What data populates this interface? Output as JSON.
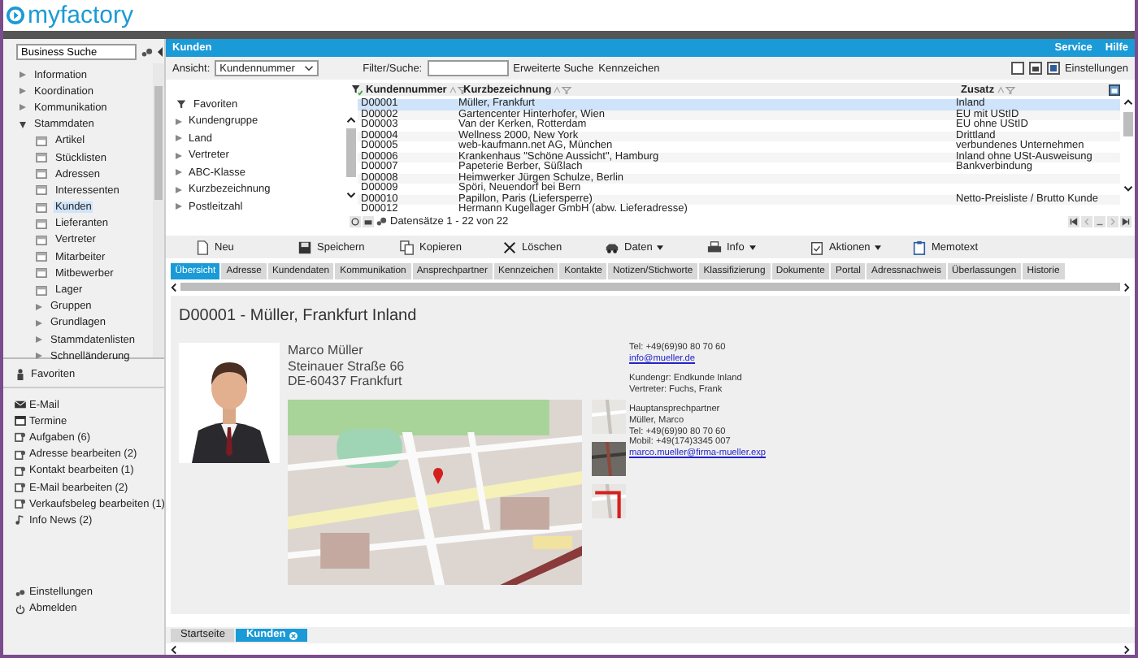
{
  "header": {
    "logo": "myfactory"
  },
  "sidebar": {
    "search": {
      "value": "Business Suche"
    },
    "tree": [
      {
        "label": "Information",
        "kind": "folder",
        "expanded": false,
        "selected": false
      },
      {
        "label": "Koordination",
        "kind": "folder",
        "expanded": false,
        "selected": false
      },
      {
        "label": "Kommunikation",
        "kind": "folder",
        "expanded": false,
        "selected": false
      },
      {
        "label": "Stammdaten",
        "kind": "folder",
        "expanded": true,
        "selected": false,
        "children": [
          {
            "label": "Artikel",
            "kind": "page",
            "selected": false
          },
          {
            "label": "Stücklisten",
            "kind": "page",
            "selected": false
          },
          {
            "label": "Adressen",
            "kind": "page",
            "selected": false
          },
          {
            "label": "Interessenten",
            "kind": "page",
            "selected": false
          },
          {
            "label": "Kunden",
            "kind": "page",
            "selected": true
          },
          {
            "label": "Lieferanten",
            "kind": "page",
            "selected": false
          },
          {
            "label": "Vertreter",
            "kind": "page",
            "selected": false
          },
          {
            "label": "Mitarbeiter",
            "kind": "page",
            "selected": false
          },
          {
            "label": "Mitbewerber",
            "kind": "page",
            "selected": false
          },
          {
            "label": "Lager",
            "kind": "page",
            "selected": false
          },
          {
            "label": "Gruppen",
            "kind": "folder",
            "expanded": false,
            "selected": false
          },
          {
            "label": "Grundlagen",
            "kind": "folder",
            "expanded": false,
            "selected": false
          },
          {
            "label": "Stammdatenlisten",
            "kind": "folder",
            "expanded": false,
            "selected": false
          },
          {
            "label": "Schnelländerung",
            "kind": "folder",
            "expanded": false,
            "selected": false
          }
        ]
      }
    ],
    "favorites_title": "Favoriten",
    "favorites": [
      {
        "kind": "mail",
        "label": "E-Mail"
      },
      {
        "kind": "calendar",
        "label": "Termine"
      },
      {
        "kind": "task",
        "label": "Aufgaben (6)"
      },
      {
        "kind": "task",
        "label": "Adresse bearbeiten (2)"
      },
      {
        "kind": "task",
        "label": "Kontakt bearbeiten (1)"
      },
      {
        "kind": "task",
        "label": "E-Mail bearbeiten (2)"
      },
      {
        "kind": "task",
        "label": "Verkaufsbeleg bearbeiten (1)"
      },
      {
        "kind": "news",
        "label": "Info News (2)"
      }
    ],
    "footer": [
      {
        "kind": "settings",
        "label": "Einstellungen"
      },
      {
        "kind": "logout",
        "label": "Abmelden"
      }
    ]
  },
  "main": {
    "title": "Kunden",
    "links": [
      "Service",
      "Hilfe"
    ],
    "view": {
      "label": "Ansicht:",
      "value": "Kundennummer"
    },
    "filter": {
      "label": "Filter/Suche:"
    },
    "extended_search": "Erweiterte Suche",
    "tags": "Kennzeichen",
    "settings": "Einstellungen",
    "filter_tree": [
      {
        "kind": "favorites",
        "label": "Favoriten"
      },
      {
        "kind": "group",
        "label": "Kundengruppe",
        "expanded": false
      },
      {
        "kind": "group",
        "label": "Land",
        "expanded": false
      },
      {
        "kind": "group",
        "label": "Vertreter",
        "expanded": false
      },
      {
        "kind": "group",
        "label": "ABC-Klasse",
        "expanded": false
      },
      {
        "kind": "group",
        "label": "Kurzbezeichnung",
        "expanded": false
      },
      {
        "kind": "group",
        "label": "Postleitzahl",
        "expanded": false
      }
    ],
    "table": {
      "columns": [
        "Kundennummer",
        "Kurzbezeichnung",
        "Zusatz"
      ],
      "rows": [
        {
          "cells": [
            "D00001",
            "Müller, Frankfurt",
            "Inland"
          ],
          "selected": true
        },
        {
          "cells": [
            "D00002",
            "Gartencenter Hinterhofer, Wien",
            "EU mit UStID"
          ],
          "selected": false
        },
        {
          "cells": [
            "D00003",
            "Van der Kerken, Rotterdam",
            "EU ohne UStID"
          ],
          "selected": false
        },
        {
          "cells": [
            "D00004",
            "Wellness 2000, New York",
            "Drittland"
          ],
          "selected": false
        },
        {
          "cells": [
            "D00005",
            "web-kaufmann.net AG, München",
            "verbundenes Unternehmen"
          ],
          "selected": false
        },
        {
          "cells": [
            "D00006",
            "Krankenhaus \"Schöne Aussicht\", Hamburg",
            "Inland ohne USt-Ausweisung"
          ],
          "selected": false
        },
        {
          "cells": [
            "D00007",
            "Papeterie Berber, Süßlach",
            "Bankverbindung"
          ],
          "selected": false
        },
        {
          "cells": [
            "D00008",
            "Heimwerker Jürgen Schulze, Berlin"
          ],
          "selected": false
        },
        {
          "cells": [
            "D00009",
            "Spöri, Neuendorf bei Bern"
          ],
          "selected": false
        },
        {
          "cells": [
            "D00010",
            "Papillon, Paris (Liefersperre)",
            "Netto-Preisliste / Brutto Kunde"
          ],
          "selected": false
        },
        {
          "cells": [
            "D00012",
            "Hermann Kugellager GmbH (abw. Lieferadresse)"
          ],
          "selected": false
        }
      ]
    },
    "pager": {
      "info": "Datensätze 1 - 22 von 22"
    },
    "toolbar": [
      {
        "kind": "new",
        "label": "Neu",
        "dropdown": false
      },
      {
        "kind": "save",
        "label": "Speichern",
        "dropdown": false
      },
      {
        "kind": "copy",
        "label": "Kopieren",
        "dropdown": false
      },
      {
        "kind": "delete",
        "label": "Löschen",
        "dropdown": false
      },
      {
        "kind": "data",
        "label": "Daten",
        "dropdown": true
      },
      {
        "kind": "info",
        "label": "Info",
        "dropdown": true
      },
      {
        "kind": "actions",
        "label": "Aktionen",
        "dropdown": true
      },
      {
        "kind": "memo",
        "label": "Memotext",
        "dropdown": false
      }
    ],
    "tabs": [
      {
        "label": "Übersicht",
        "selected": true
      },
      {
        "label": "Adresse",
        "selected": false
      },
      {
        "label": "Kundendaten",
        "selected": false
      },
      {
        "label": "Kommunikation",
        "selected": false
      },
      {
        "label": "Ansprechpartner",
        "selected": false
      },
      {
        "label": "Kennzeichen",
        "selected": false
      },
      {
        "label": "Kontakte",
        "selected": false
      },
      {
        "label": "Notizen/Stichworte",
        "selected": false
      },
      {
        "label": "Klassifizierung",
        "selected": false
      },
      {
        "label": "Dokumente",
        "selected": false
      },
      {
        "label": "Portal",
        "selected": false
      },
      {
        "label": "Adressnachweis",
        "selected": false
      },
      {
        "label": "Überlassungen",
        "selected": false
      },
      {
        "label": "Historie",
        "selected": false
      }
    ],
    "detail": {
      "heading": "D00001 - Müller, Frankfurt Inland",
      "address": [
        "Marco Müller",
        "Steinauer Straße 66",
        "DE-60437 Frankfurt"
      ],
      "info": [
        {
          "lines": [
            {
              "kind": "text",
              "text": "Tel: +49(69)90 80 70 60"
            },
            {
              "kind": "link",
              "text": "info@mueller.de"
            }
          ]
        },
        {
          "lines": [
            {
              "kind": "text",
              "text": "Kundengr: Endkunde Inland"
            },
            {
              "kind": "text",
              "text": "Vertreter: Fuchs, Frank"
            }
          ]
        },
        {
          "lines": [
            {
              "kind": "text",
              "text": "Hauptansprechpartner"
            },
            {
              "kind": "text",
              "text": "Müller, Marco"
            },
            {
              "kind": "text",
              "text": "Tel: +49(69)90 80 70 60"
            },
            {
              "kind": "text",
              "text": "Mobil: +49(174)3345 007"
            },
            {
              "kind": "link",
              "text": "marco.mueller@firma-mueller.exp"
            }
          ]
        }
      ]
    },
    "bottom_tabs": [
      {
        "label": "Startseite",
        "selected": false,
        "closable": false
      },
      {
        "label": "Kunden",
        "selected": true,
        "closable": true
      }
    ]
  }
}
